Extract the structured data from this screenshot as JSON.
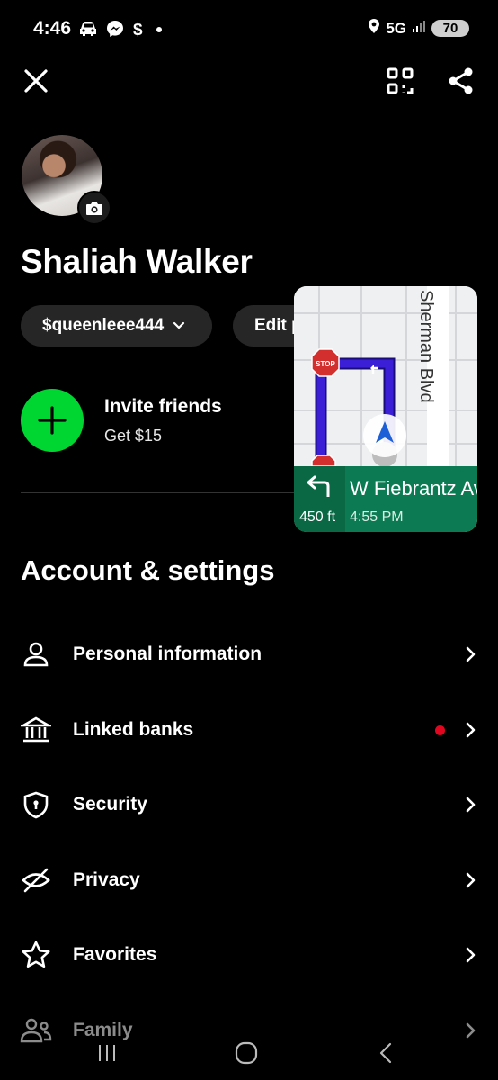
{
  "status_bar": {
    "time": "4:46",
    "network": "5G",
    "battery": "70",
    "icons": [
      "car-icon",
      "messenger-icon",
      "dollar-icon",
      "dot-icon",
      "location-icon",
      "signal-icon"
    ]
  },
  "header": {
    "close_icon": "close-icon",
    "qr_icon": "qr-scan-icon",
    "share_icon": "share-icon"
  },
  "profile": {
    "name": "Shaliah Walker",
    "cashtag": "$queenleee444",
    "edit_label": "Edit p"
  },
  "invite": {
    "title": "Invite friends",
    "subtitle": "Get $15",
    "accent": "#00d632"
  },
  "section": {
    "title": "Account & settings"
  },
  "settings_items": [
    {
      "label": "Personal information",
      "icon": "person-icon"
    },
    {
      "label": "Linked banks",
      "icon": "bank-icon",
      "badge": true
    },
    {
      "label": "Security",
      "icon": "shield-icon"
    },
    {
      "label": "Privacy",
      "icon": "eye-off-icon"
    },
    {
      "label": "Favorites",
      "icon": "star-icon"
    },
    {
      "label": "Family",
      "icon": "family-icon"
    }
  ],
  "map_overlay": {
    "cross_street": "Sherman Blvd",
    "next_street": "W Fiebrantz Ave",
    "distance": "450 ft",
    "eta": "4:55 PM",
    "stop_sign_text": "STOP",
    "banner_color": "#0c7a52",
    "route_color": "#3a1fd6"
  },
  "nav_bar": {
    "recents": "recents-icon",
    "home": "home-icon",
    "back": "back-icon"
  }
}
